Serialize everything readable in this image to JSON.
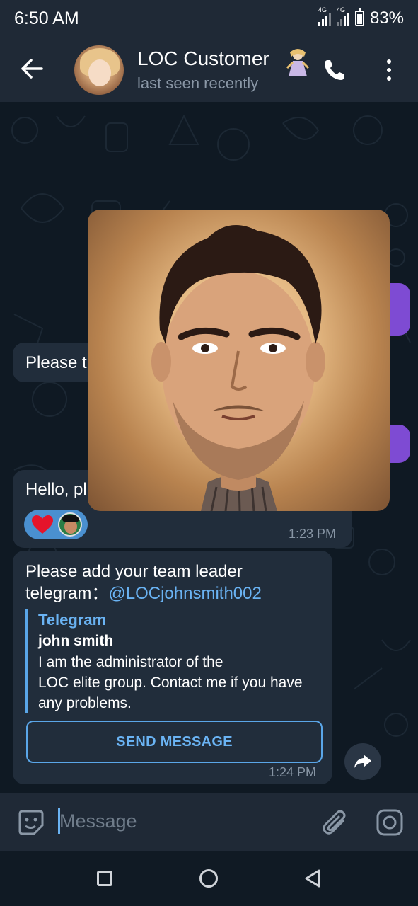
{
  "status_bar": {
    "time": "6:50 AM",
    "network_1": "4G",
    "network_2": "4G",
    "battery": "83%"
  },
  "header": {
    "title": "LOC Customer",
    "subtitle": "last seen recently"
  },
  "messages": {
    "partial_1": "Please t",
    "partial_2": "Hello, pl",
    "time_1": "1:23 PM",
    "main_line1": "Please add your team leader",
    "main_line2_prefix": "telegram：",
    "main_mention": "@LOCjohnsmith002",
    "quote_title": "Telegram",
    "quote_name": "john smith",
    "quote_body_1": "I am the administrator of the",
    "quote_body_2": "LOC elite group. Contact me if you have",
    "quote_body_3": "any problems.",
    "send_button": "SEND MESSAGE",
    "time_2": "1:24 PM"
  },
  "input": {
    "placeholder": "Message"
  },
  "icons": {
    "back": "arrow-left-icon",
    "call": "phone-icon",
    "menu": "more-vertical-icon",
    "emoji": "sticker-icon",
    "attach": "paperclip-icon",
    "camera": "camera-icon",
    "share": "forward-icon"
  },
  "colors": {
    "header_bg": "#1f2936",
    "chat_bg": "#0f1923",
    "incoming_bubble": "#212d3b",
    "outgoing_bubble": "#7e4bd3",
    "accent": "#6ab3f3"
  }
}
